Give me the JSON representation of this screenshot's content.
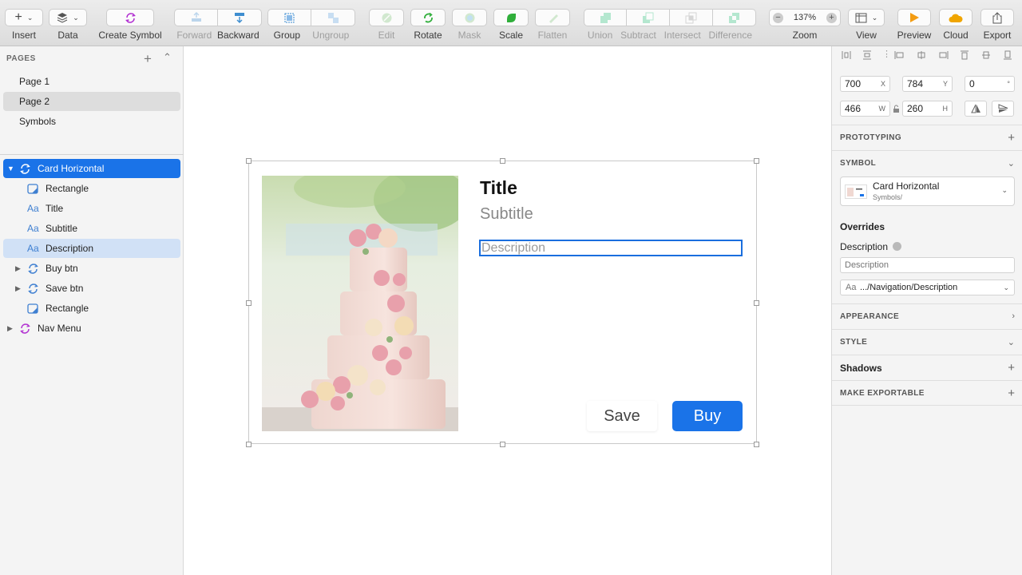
{
  "toolbar": {
    "insert": "Insert",
    "data": "Data",
    "create_symbol": "Create Symbol",
    "forward": "Forward",
    "backward": "Backward",
    "group": "Group",
    "ungroup": "Ungroup",
    "edit": "Edit",
    "rotate": "Rotate",
    "mask": "Mask",
    "scale": "Scale",
    "flatten": "Flatten",
    "union": "Union",
    "subtract": "Subtract",
    "intersect": "Intersect",
    "difference": "Difference",
    "zoom_label": "Zoom",
    "zoom_value": "137%",
    "view": "View",
    "preview": "Preview",
    "cloud": "Cloud",
    "export": "Export"
  },
  "pages": {
    "header": "PAGES",
    "items": [
      "Page 1",
      "Page 2",
      "Symbols"
    ],
    "selected": "Page 2"
  },
  "layers": [
    {
      "name": "Card Horizontal",
      "icon": "symbol-icon",
      "state": "selected"
    },
    {
      "name": "Rectangle",
      "icon": "shape-icon"
    },
    {
      "name": "Title",
      "icon": "text-icon"
    },
    {
      "name": "Subtitle",
      "icon": "text-icon"
    },
    {
      "name": "Description",
      "icon": "text-icon",
      "state": "highlighted"
    },
    {
      "name": "Buy btn",
      "icon": "symbol-icon"
    },
    {
      "name": "Save btn",
      "icon": "symbol-icon"
    },
    {
      "name": "Rectangle",
      "icon": "shape-icon"
    },
    {
      "name": "Nav Menu",
      "icon": "symbol-icon"
    }
  ],
  "card": {
    "title": "Title",
    "subtitle": "Subtitle",
    "description_placeholder": "Description",
    "save": "Save",
    "buy": "Buy"
  },
  "inspector": {
    "x": "700",
    "x_unit": "X",
    "y": "784",
    "y_unit": "Y",
    "rotation": "0",
    "rotation_unit": "°",
    "w": "466",
    "w_unit": "W",
    "h": "260",
    "h_unit": "H",
    "prototyping": "PROTOTYPING",
    "symbol": "SYMBOL",
    "symbol_name": "Card Horizontal",
    "symbol_path": "Symbols/",
    "overrides": "Overrides",
    "override_description": "Description",
    "override_placeholder": "Description",
    "override_style": ".../Navigation/Description",
    "appearance": "APPEARANCE",
    "style": "STYLE",
    "shadows": "Shadows",
    "make_exportable": "MAKE EXPORTABLE"
  },
  "colors": {
    "accent": "#1a73e8",
    "symbol_purple": "#b12fd1",
    "text_blue": "#3e7fd1"
  }
}
